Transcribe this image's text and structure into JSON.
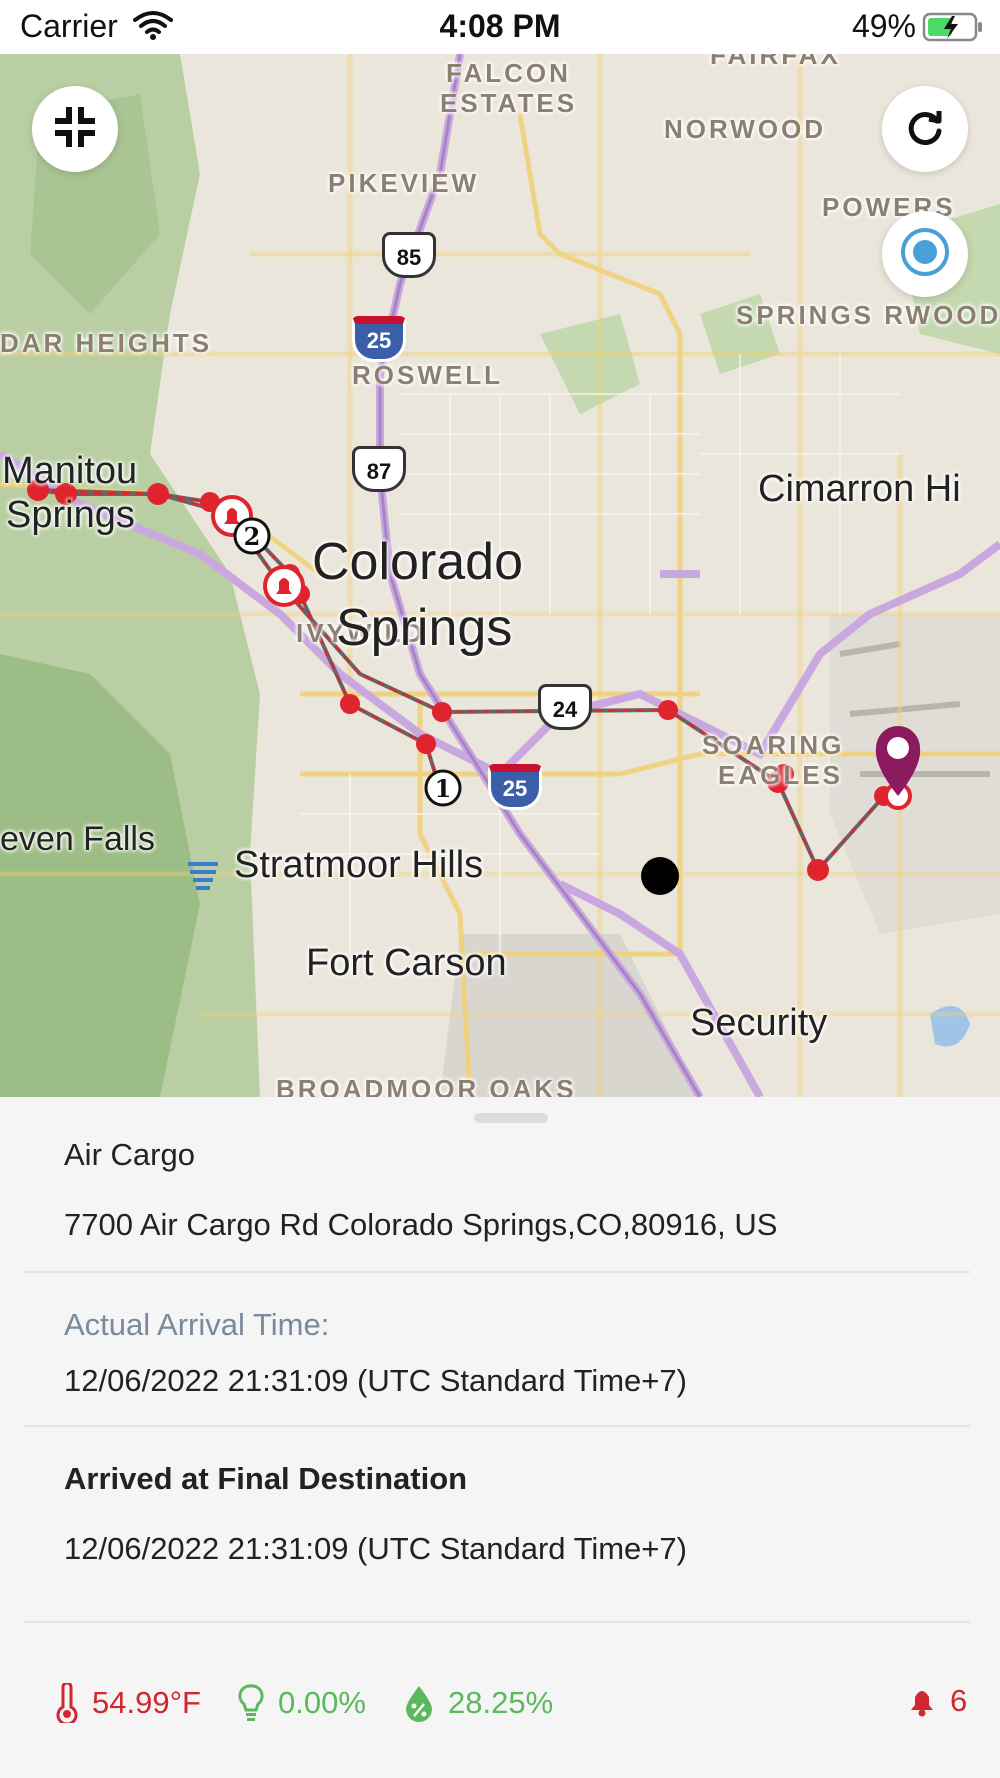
{
  "status_bar": {
    "carrier": "Carrier",
    "time": "4:08 PM",
    "battery": "49%"
  },
  "map": {
    "places_large": [
      "Colorado",
      "Springs"
    ],
    "places_medium": [
      "Manitou",
      "Springs",
      "Cimarron Hi",
      "Stratmoor Hills",
      "Fort Carson",
      "Security",
      "even Falls"
    ],
    "places_small": [
      "FALCON",
      "ESTATES",
      "NORWOOD",
      "PIKEVIEW",
      "DAR HEIGHTS",
      "ROSWELL",
      "SPRINGS RWOOD",
      "POWERS",
      "IVYWILD",
      "SOARING",
      "EAGLES",
      "BROADMOOR OAKS",
      "FAIRFAX"
    ],
    "highways": [
      "85",
      "25",
      "87",
      "24",
      "25"
    ],
    "stop_markers": [
      "1",
      "2"
    ]
  },
  "details": {
    "name": "Air Cargo",
    "address": "7700 Air Cargo Rd Colorado Springs,CO,80916, US",
    "arrival_label": "Actual Arrival Time:",
    "arrival_value": "12/06/2022 21:31:09 (UTC Standard Time+7)",
    "event_title": "Arrived at Final Destination",
    "event_time": "12/06/2022 21:31:09 (UTC Standard Time+7)"
  },
  "sensors": {
    "temperature": "54.99°F",
    "light": "0.00%",
    "humidity": "28.25%",
    "alerts": "6"
  },
  "colors": {
    "alert_red": "#d22630",
    "ok_green": "#5cb85c",
    "destination_purple": "#8b1a5e",
    "route_red": "#e0242e"
  }
}
